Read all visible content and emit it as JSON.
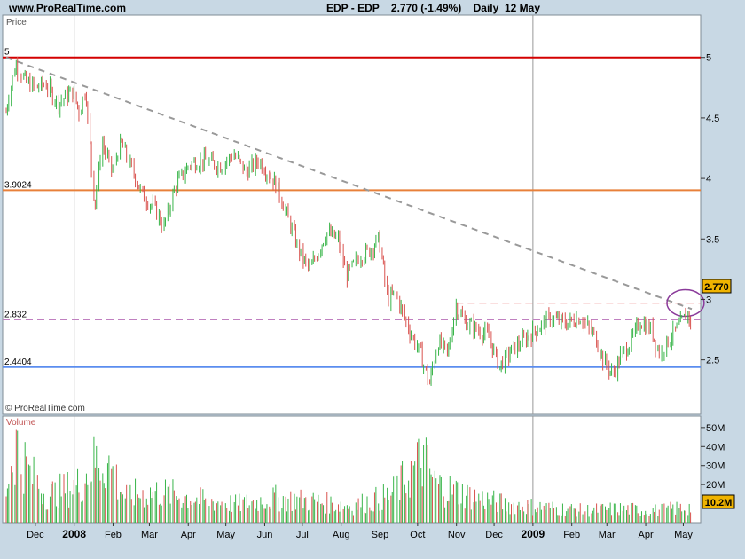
{
  "header": {
    "site": "www.ProRealTime.com",
    "info": "EDP - EDP    2.770 (-1.49%)    Daily  12 May"
  },
  "price_panel": {
    "label": "Price",
    "watermark": "© ProRealTime.com",
    "last_price_badge": "2.770"
  },
  "volume_panel": {
    "label": "Volume",
    "last_volume_badge": "10.2M"
  },
  "chart_data": [
    {
      "type": "ohlc",
      "x_axis": {
        "ticks": [
          "Dec",
          "2008",
          "Feb",
          "Mar",
          "Apr",
          "May",
          "Jun",
          "Jul",
          "Aug",
          "Sep",
          "Oct",
          "Nov",
          "Dec",
          "2009",
          "Feb",
          "Mar",
          "Apr",
          "May"
        ],
        "bold_ticks": [
          "2008",
          "2009"
        ],
        "range": [
          "2007-11-12",
          "2009-05-12"
        ]
      },
      "y_axis": {
        "ticks": [
          2.5,
          3,
          3.5,
          4,
          4.5,
          5
        ],
        "tick_labels": [
          "2.5",
          "3",
          "3.5",
          "4",
          "4.5",
          "5"
        ],
        "ylim": [
          2.05,
          5.35
        ]
      },
      "colors": {
        "up": "#39b54a",
        "down": "#d9534f"
      },
      "series": [
        {
          "values": [
            [
              "2007-11-12",
              4.55
            ],
            [
              "2007-11-20",
              4.95
            ],
            [
              "2007-11-28",
              4.8
            ],
            [
              "2007-12-06",
              4.75
            ],
            [
              "2007-12-14",
              4.78
            ],
            [
              "2007-12-24",
              4.62
            ],
            [
              "2008-01-04",
              4.72
            ],
            [
              "2008-01-10",
              4.55
            ],
            [
              "2008-01-15",
              4.75
            ],
            [
              "2008-01-22",
              3.75
            ],
            [
              "2008-01-28",
              4.3
            ],
            [
              "2008-02-05",
              4.05
            ],
            [
              "2008-02-12",
              4.3
            ],
            [
              "2008-02-20",
              4.1
            ],
            [
              "2008-03-01",
              3.85
            ],
            [
              "2008-03-10",
              3.75
            ],
            [
              "2008-03-17",
              3.6
            ],
            [
              "2008-03-27",
              3.95
            ],
            [
              "2008-04-07",
              4.12
            ],
            [
              "2008-04-20",
              4.15
            ],
            [
              "2008-05-01",
              4.1
            ],
            [
              "2008-05-12",
              4.2
            ],
            [
              "2008-05-22",
              4.05
            ],
            [
              "2008-06-01",
              4.15
            ],
            [
              "2008-06-15",
              3.95
            ],
            [
              "2008-06-25",
              3.65
            ],
            [
              "2008-07-05",
              3.35
            ],
            [
              "2008-07-12",
              3.25
            ],
            [
              "2008-07-25",
              3.55
            ],
            [
              "2008-08-03",
              3.5
            ],
            [
              "2008-08-10",
              3.2
            ],
            [
              "2008-08-20",
              3.35
            ],
            [
              "2008-08-28",
              3.4
            ],
            [
              "2008-09-05",
              3.5
            ],
            [
              "2008-09-12",
              3.0
            ],
            [
              "2008-09-18",
              3.05
            ],
            [
              "2008-09-29",
              2.75
            ],
            [
              "2008-10-08",
              2.55
            ],
            [
              "2008-10-15",
              2.3
            ],
            [
              "2008-10-22",
              2.65
            ],
            [
              "2008-10-30",
              2.55
            ],
            [
              "2008-11-05",
              2.95
            ],
            [
              "2008-11-12",
              2.82
            ],
            [
              "2008-11-22",
              2.75
            ],
            [
              "2008-12-01",
              2.7
            ],
            [
              "2008-12-10",
              2.45
            ],
            [
              "2008-12-20",
              2.58
            ],
            [
              "2009-01-05",
              2.72
            ],
            [
              "2009-01-20",
              2.85
            ],
            [
              "2009-02-01",
              2.8
            ],
            [
              "2009-02-12",
              2.85
            ],
            [
              "2009-02-24",
              2.7
            ],
            [
              "2009-03-03",
              2.5
            ],
            [
              "2009-03-10",
              2.38
            ],
            [
              "2009-03-18",
              2.55
            ],
            [
              "2009-03-25",
              2.65
            ],
            [
              "2009-04-01",
              2.82
            ],
            [
              "2009-04-10",
              2.75
            ],
            [
              "2009-04-17",
              2.55
            ],
            [
              "2009-04-28",
              2.72
            ],
            [
              "2009-05-05",
              2.82
            ],
            [
              "2009-05-10",
              2.9
            ],
            [
              "2009-05-12",
              2.77
            ]
          ]
        }
      ],
      "annotations": [
        {
          "label": "5",
          "value": 5,
          "color": "#d40000",
          "style": "solid"
        },
        {
          "label": "3.9024",
          "value": 3.9024,
          "color": "#e8803a",
          "style": "solid"
        },
        {
          "label": "2.4404",
          "value": 2.4404,
          "color": "#5b8def",
          "style": "solid"
        },
        {
          "label": "2.832",
          "value": 2.832,
          "color": "#c080c0",
          "style": "dashed"
        },
        {
          "value": 2.97,
          "color": "#d40000",
          "style": "dashed",
          "from": "2008-11-05"
        },
        {
          "trendline_from": [
            "2007-11-12",
            5.0
          ],
          "trendline_to": [
            "2009-05-12",
            2.92
          ],
          "color": "#999999",
          "style": "dashed"
        },
        {
          "circle_at": [
            "2009-05-07",
            2.97
          ],
          "color": "#8a3a9a"
        }
      ]
    },
    {
      "type": "bar",
      "title": "Volume",
      "y_axis": {
        "ticks": [
          20000000,
          30000000,
          40000000,
          50000000
        ],
        "tick_labels": [
          "20M",
          "30M",
          "40M",
          "50M"
        ],
        "ylim": [
          0,
          56000000
        ]
      },
      "values": [
        [
          "2007-11-12",
          22000000
        ],
        [
          "2007-11-20",
          52000000
        ],
        [
          "2007-12-01",
          32000000
        ],
        [
          "2007-12-15",
          18000000
        ],
        [
          "2008-01-10",
          25000000
        ],
        [
          "2008-01-22",
          40000000
        ],
        [
          "2008-02-01",
          40000000
        ],
        [
          "2008-02-15",
          18000000
        ],
        [
          "2008-03-15",
          20000000
        ],
        [
          "2008-04-15",
          15000000
        ],
        [
          "2008-05-15",
          12000000
        ],
        [
          "2008-06-15",
          16000000
        ],
        [
          "2008-07-15",
          14000000
        ],
        [
          "2008-08-15",
          11000000
        ],
        [
          "2008-09-15",
          18000000
        ],
        [
          "2008-10-10",
          42000000
        ],
        [
          "2008-10-20",
          25000000
        ],
        [
          "2008-11-15",
          18000000
        ],
        [
          "2008-12-15",
          12000000
        ],
        [
          "2009-01-15",
          10000000
        ],
        [
          "2009-02-15",
          8000000
        ],
        [
          "2009-03-15",
          9000000
        ],
        [
          "2009-04-15",
          8000000
        ],
        [
          "2009-05-12",
          10200000
        ]
      ]
    }
  ]
}
